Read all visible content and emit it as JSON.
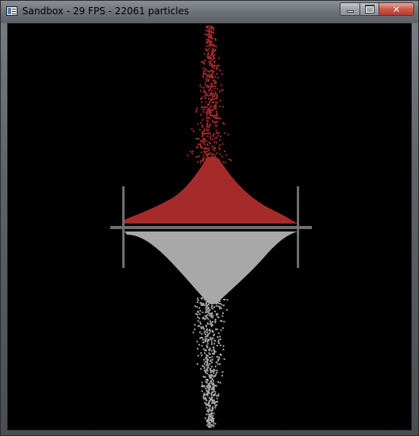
{
  "window": {
    "title": "Sandbox - 29 FPS - 22061 particles",
    "app_icon": "window-app-icon",
    "buttons": [
      {
        "name": "minimize",
        "icon": "minimize-icon"
      },
      {
        "name": "maximize",
        "icon": "maximize-icon"
      },
      {
        "name": "close",
        "icon": "close-icon",
        "glyph": "✕"
      }
    ]
  },
  "scene": {
    "colors": {
      "background": "#000000",
      "red_particles": "#a52a2a",
      "grey_particles": "#a8a8a8",
      "divider": "#6e6e6e"
    },
    "objects": [
      "horizontal-divider-bar",
      "left-vertical-post",
      "right-vertical-post",
      "red-particle-pile",
      "grey-particle-pile",
      "red-particle-stream",
      "grey-particle-stream"
    ]
  }
}
